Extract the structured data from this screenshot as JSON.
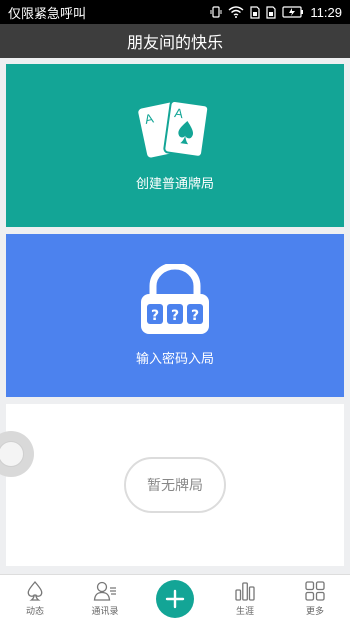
{
  "status_bar": {
    "carrier": "仅限紧急呼叫",
    "time": "11:29",
    "icons": [
      "vibrate-icon",
      "wifi-icon",
      "sim1-icon",
      "sim2-icon",
      "battery-icon"
    ]
  },
  "header": {
    "title": "朋友间的快乐"
  },
  "cards": {
    "create": {
      "label": "创建普通牌局",
      "icon": "playing-cards-icon",
      "color": "#13a596"
    },
    "join": {
      "label": "输入密码入局",
      "icon": "padlock-icon",
      "color": "#4c82ee"
    }
  },
  "empty_state": {
    "label": "暂无牌局"
  },
  "bottom_nav": {
    "items": [
      {
        "label": "动态",
        "icon": "spade-icon"
      },
      {
        "label": "通讯录",
        "icon": "contacts-icon"
      },
      {
        "label": "",
        "icon": "plus-icon"
      },
      {
        "label": "生涯",
        "icon": "bar-chart-icon"
      },
      {
        "label": "更多",
        "icon": "grid-icon"
      }
    ]
  }
}
